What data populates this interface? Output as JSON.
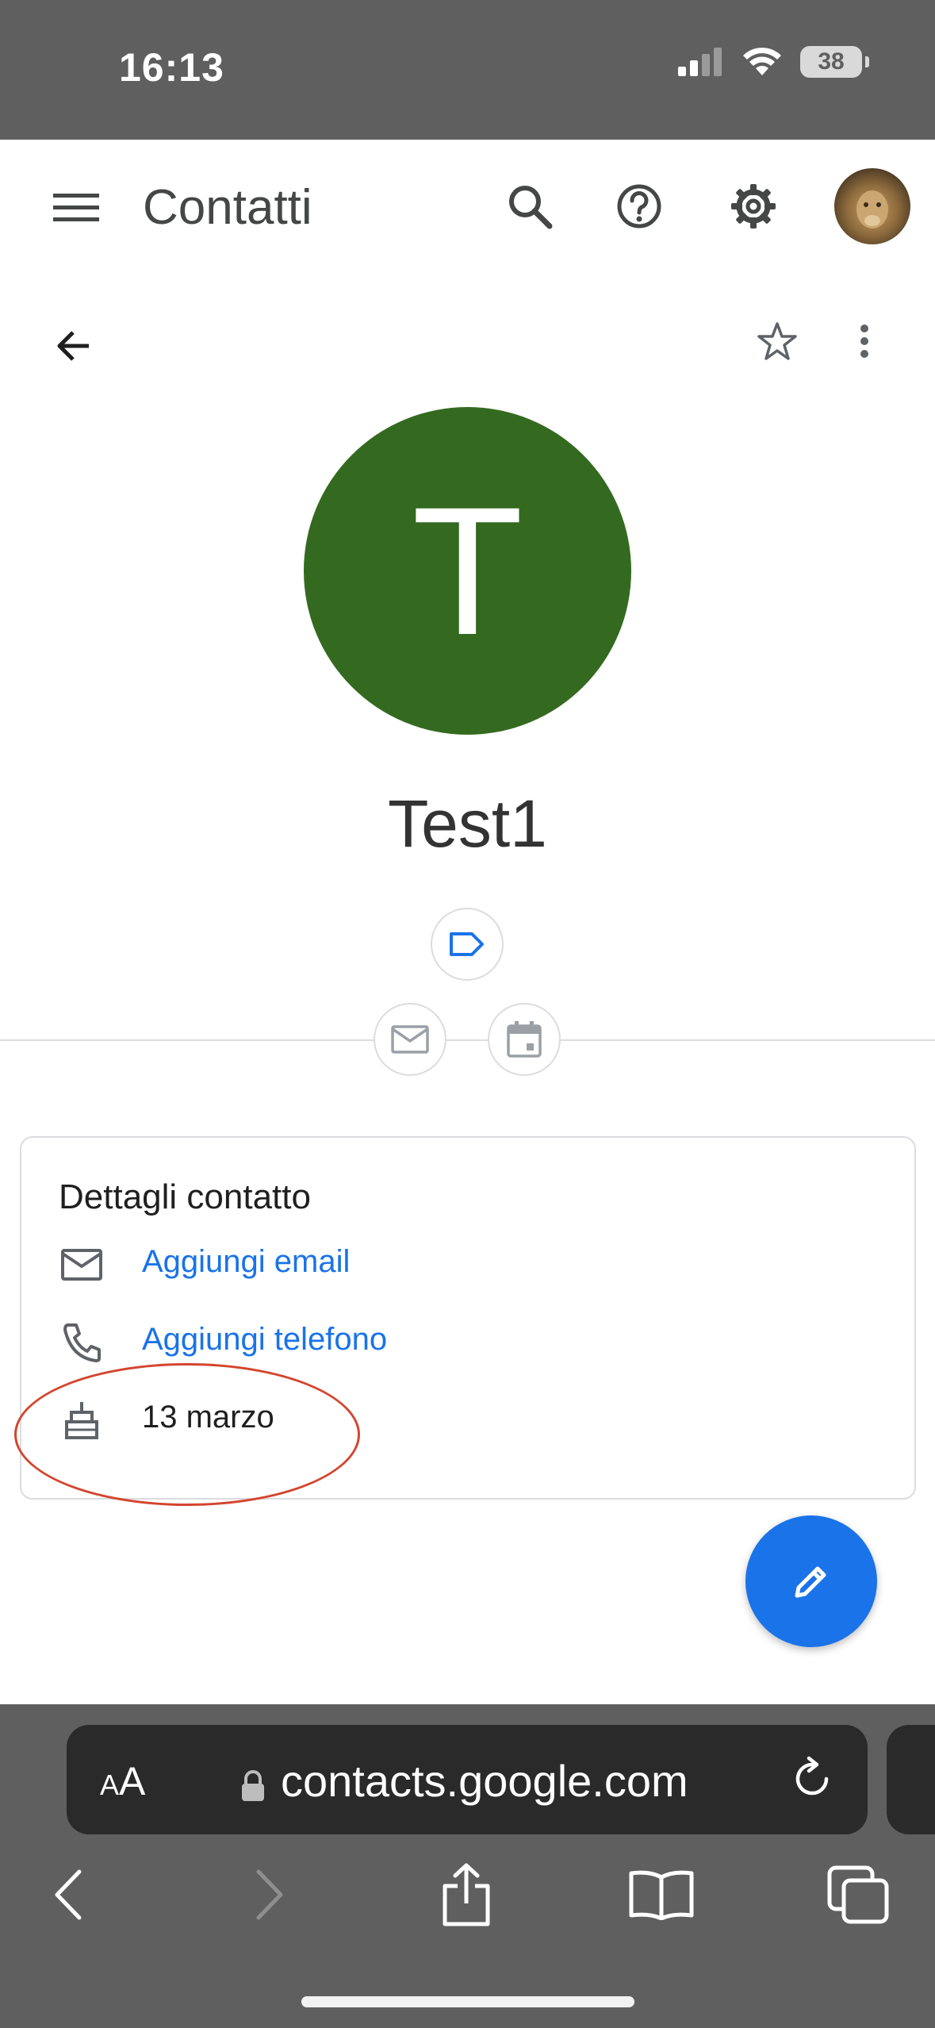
{
  "status_bar": {
    "time": "16:13",
    "battery": "38"
  },
  "app_bar": {
    "title": "Contatti"
  },
  "contact": {
    "initial": "T",
    "name": "Test1",
    "avatar_color": "#346a20"
  },
  "details_card": {
    "title": "Dettagli contatto",
    "add_email": "Aggiungi email",
    "add_phone": "Aggiungi telefono",
    "birthday": "13 marzo"
  },
  "browser": {
    "text_size_label_small": "A",
    "text_size_label_large": "A",
    "url": "contacts.google.com"
  },
  "colors": {
    "accent": "#1a73e8",
    "status_bar": "#5f5f5f",
    "annotation": "#d3452e"
  }
}
